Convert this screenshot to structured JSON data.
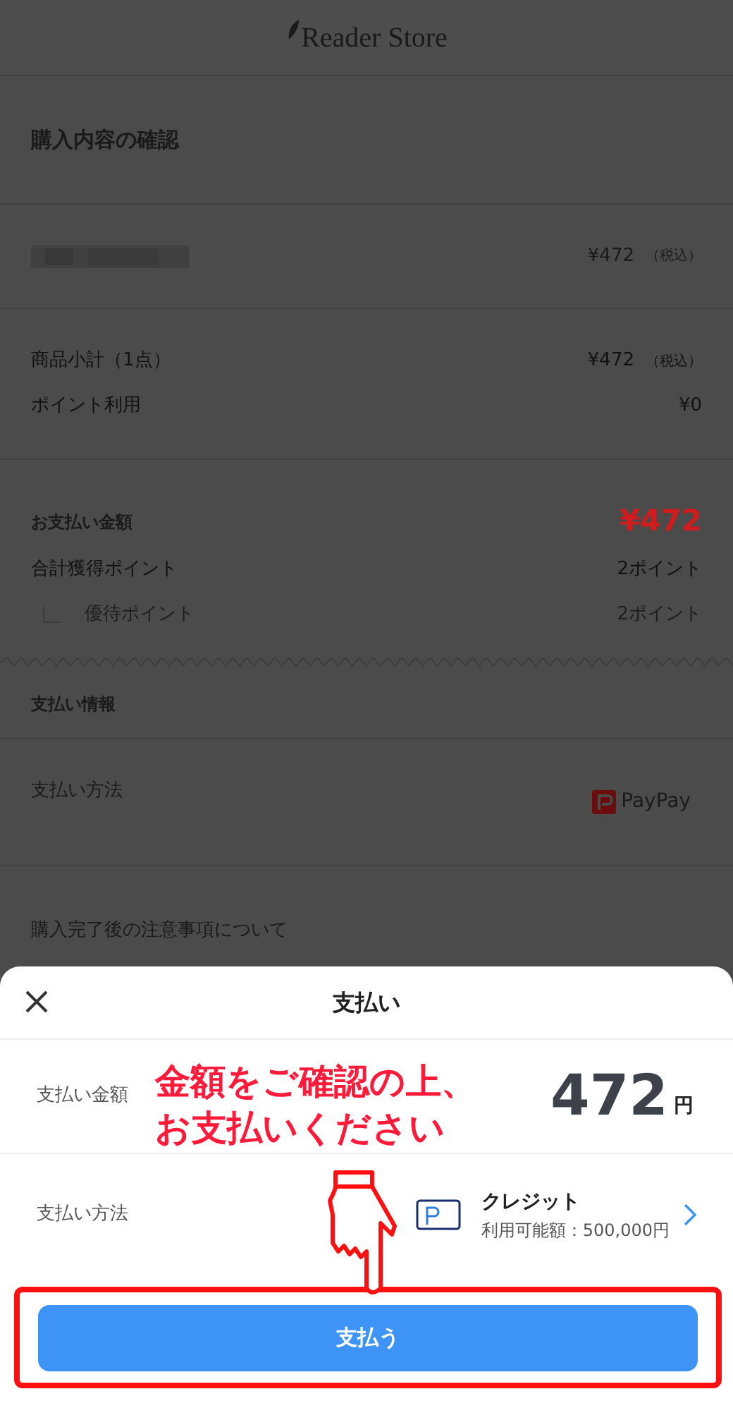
{
  "header": {
    "logo_text": "Reader Store"
  },
  "page": {
    "title": "購入内容の確認",
    "item": {
      "price": "¥472",
      "tax_note": "（税込）"
    },
    "summary": [
      {
        "label": "商品小計（1点）",
        "value": "¥472",
        "tax_note": "（税込）"
      },
      {
        "label": "ポイント利用",
        "value": "¥0"
      }
    ],
    "total": {
      "label": "お支払い金額",
      "value": "¥472"
    },
    "points": [
      {
        "label": "合計獲得ポイント",
        "value": "2ポイント",
        "kind": "main"
      },
      {
        "label": "優待ポイント",
        "value": "2ポイント",
        "kind": "sub"
      }
    ],
    "payment_info": {
      "title": "支払い情報",
      "method_label": "支払い方法",
      "method": "PayPay"
    },
    "notes_heading": "購入完了後の注意事項について"
  },
  "sheet": {
    "title": "支払い",
    "amount_label": "支払い金額",
    "amount": "472",
    "currency": "円",
    "method_label": "支払い方法",
    "method_name": "クレジット",
    "method_limit": "利用可能額：500,000円",
    "pay_button": "支払う"
  },
  "annotation": {
    "lines": [
      "金額をご確認の上、",
      "お支払いください"
    ]
  }
}
